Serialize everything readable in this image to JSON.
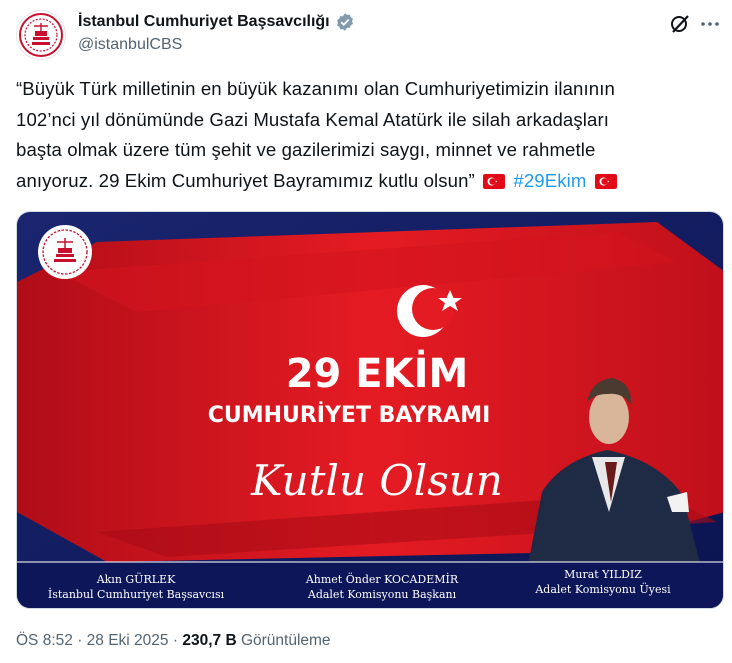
{
  "account": {
    "name": "İstanbul Cumhuriyet Başsavcılığı",
    "handle": "@istanbulCBS"
  },
  "tweet": {
    "text_line1": "“Büyük Türk milletinin en büyük kazanımı olan Cumhuriyetimizin ilanının",
    "text_line2": "102’nci yıl dönümünde Gazi Mustafa Kemal Atatürk ile silah arkadaşları",
    "text_line3": "başta olmak üzere tüm şehit ve gazilerimizi saygı, minnet ve rahmetle",
    "text_line4_start": "anıyoruz. 29 Ekim Cumhuriyet Bayramımız kutlu olsun”",
    "hashtag": "#29Ekim"
  },
  "poster": {
    "headline": "29 EKİM",
    "subheadline": "CUMHURİYET BAYRAMI",
    "script_text": "Kutlu Olsun",
    "signatures": [
      {
        "name": "Akın GÜRLEK",
        "title": "İstanbul Cumhuriyet Başsavcısı"
      },
      {
        "name": "Ahmet Önder KOCADEMİR",
        "title": "Adalet Komisyonu Başkanı"
      },
      {
        "name": "Murat YILDIZ",
        "title": "Adalet Komisyonu Üyesi"
      }
    ]
  },
  "meta": {
    "time": "ÖS 8:52",
    "date": "28 Eki 2025",
    "views_count": "230,7 B",
    "views_label": "Görüntüleme",
    "separator": "·"
  },
  "colors": {
    "brand_red": "#e30a17",
    "navy": "#0f1a5c",
    "link_blue": "#1d9bf0",
    "verified_gray": "#829aab"
  },
  "icons": {
    "verified": "verified-badge-icon",
    "grok": "grok-icon",
    "more": "more-icon",
    "flag": "turkey-flag-icon"
  }
}
